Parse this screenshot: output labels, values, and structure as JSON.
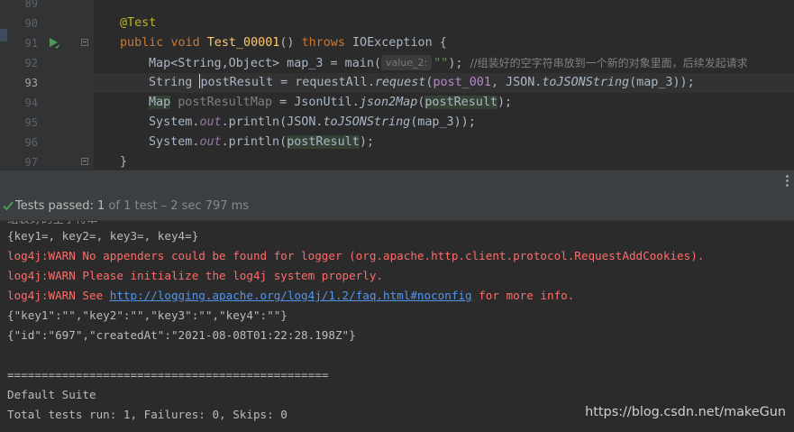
{
  "editor": {
    "line_numbers": [
      "89",
      "90",
      "91",
      "92",
      "93",
      "94",
      "95",
      "96",
      "97"
    ],
    "current_line": "93",
    "annotation": "@Test",
    "method": {
      "public": "public",
      "void": "void",
      "name": "Test_00001",
      "parens": "() ",
      "throws": "throws",
      "exception": " IOException {"
    },
    "line92": {
      "type": "Map<String,Object> map_3 = main(",
      "hint": "value_2:",
      "arg": "\"\"",
      "end": "); ",
      "comment": "//组装好的空字符串放到一个新的对象里面，后续发起请求"
    },
    "line93": {
      "decl": "String ",
      "var": "postResult",
      "assign": " = requestAll.",
      "call": "request",
      "open": "(",
      "arg1": "post_001",
      "mid": ", JSON.",
      "call2": "toJSONString",
      "end": "(map_3));"
    },
    "line94": {
      "type": "Map",
      "var": "postResultMap",
      "assign": " = JsonUtil.",
      "call": "json2Map",
      "open": "(",
      "arg": "postResult",
      "end": ");"
    },
    "line95": {
      "sys": "System.",
      "out": "out",
      "println": ".println(JSON.",
      "call": "toJSONString",
      "end": "(map_3));"
    },
    "line96": {
      "sys": "System.",
      "out": "out",
      "println": ".println(",
      "arg": "postResult",
      "end": ");"
    },
    "close_brace": "}"
  },
  "test_status": {
    "passed_label": "Tests passed: ",
    "passed_count": "1",
    "detail": " of 1 test – 2 sec 797 ms"
  },
  "console": {
    "partial_top": "组装好的空字符串",
    "lines": [
      "{key1=, key2=, key3=, key4=}",
      "log4j:WARN No appenders could be found for logger (org.apache.http.client.protocol.RequestAddCookies).",
      "log4j:WARN Please initialize the log4j system properly."
    ],
    "warn_see_prefix": "log4j:WARN See ",
    "warn_link": "http://logging.apache.org/log4j/1.2/faq.html#noconfig",
    "warn_see_suffix": " for more info.",
    "json_lines": [
      "{\"key1\":\"\",\"key2\":\"\",\"key3\":\"\",\"key4\":\"\"}",
      "{\"id\":\"697\",\"createdAt\":\"2021-08-08T01:22:28.198Z\"}"
    ],
    "separator": "===============================================",
    "suite": "Default Suite",
    "summary": "Total tests run: 1, Failures: 0, Skips: 0"
  },
  "watermark": "https://blog.csdn.net/makeGun",
  "icons": {
    "run": "run-test-icon",
    "fold": "fold-icon",
    "passed": "check-icon"
  },
  "colors": {
    "editor_bg": "#2b2b2b",
    "keyword": "#cc7832",
    "string": "#6a8759",
    "error": "#ff6b68",
    "link": "#5394ec",
    "passed": "#499c54"
  }
}
